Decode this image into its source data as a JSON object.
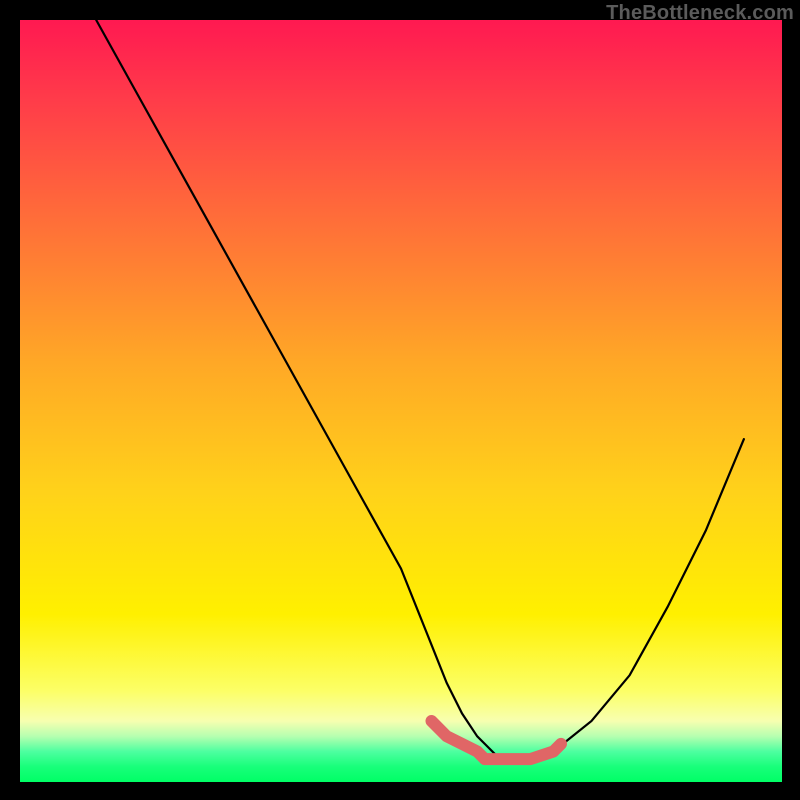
{
  "watermark": {
    "text": "TheBottleneck.com"
  },
  "colors": {
    "background_black": "#000000",
    "gradient_top": "#ff1951",
    "gradient_green": "#00ff66",
    "curve_stroke": "#000000",
    "highlight_stroke": "#e06666"
  },
  "chart_data": {
    "type": "line",
    "title": "",
    "xlabel": "",
    "ylabel": "",
    "xlim": [
      0,
      100
    ],
    "ylim": [
      0,
      100
    ],
    "grid": false,
    "legend": false,
    "series": [
      {
        "name": "bottleneck-curve",
        "x": [
          10,
          15,
          20,
          25,
          30,
          35,
          40,
          45,
          50,
          54,
          56,
          58,
          60,
          61,
          62,
          63,
          64,
          65,
          67,
          70,
          75,
          80,
          85,
          90,
          95
        ],
        "values": [
          100,
          91,
          82,
          73,
          64,
          55,
          46,
          37,
          28,
          18,
          13,
          9,
          6,
          5,
          4,
          3,
          3,
          3,
          3,
          4,
          8,
          14,
          23,
          33,
          45
        ]
      },
      {
        "name": "optimal-zone-highlight",
        "x": [
          54,
          56,
          58,
          60,
          61,
          62,
          63,
          64,
          65,
          67,
          70,
          71
        ],
        "values": [
          8,
          6,
          5,
          4,
          3,
          3,
          3,
          3,
          3,
          3,
          4,
          5
        ]
      }
    ],
    "annotations": [
      {
        "text": "TheBottleneck.com",
        "pos": "top-right"
      }
    ]
  }
}
